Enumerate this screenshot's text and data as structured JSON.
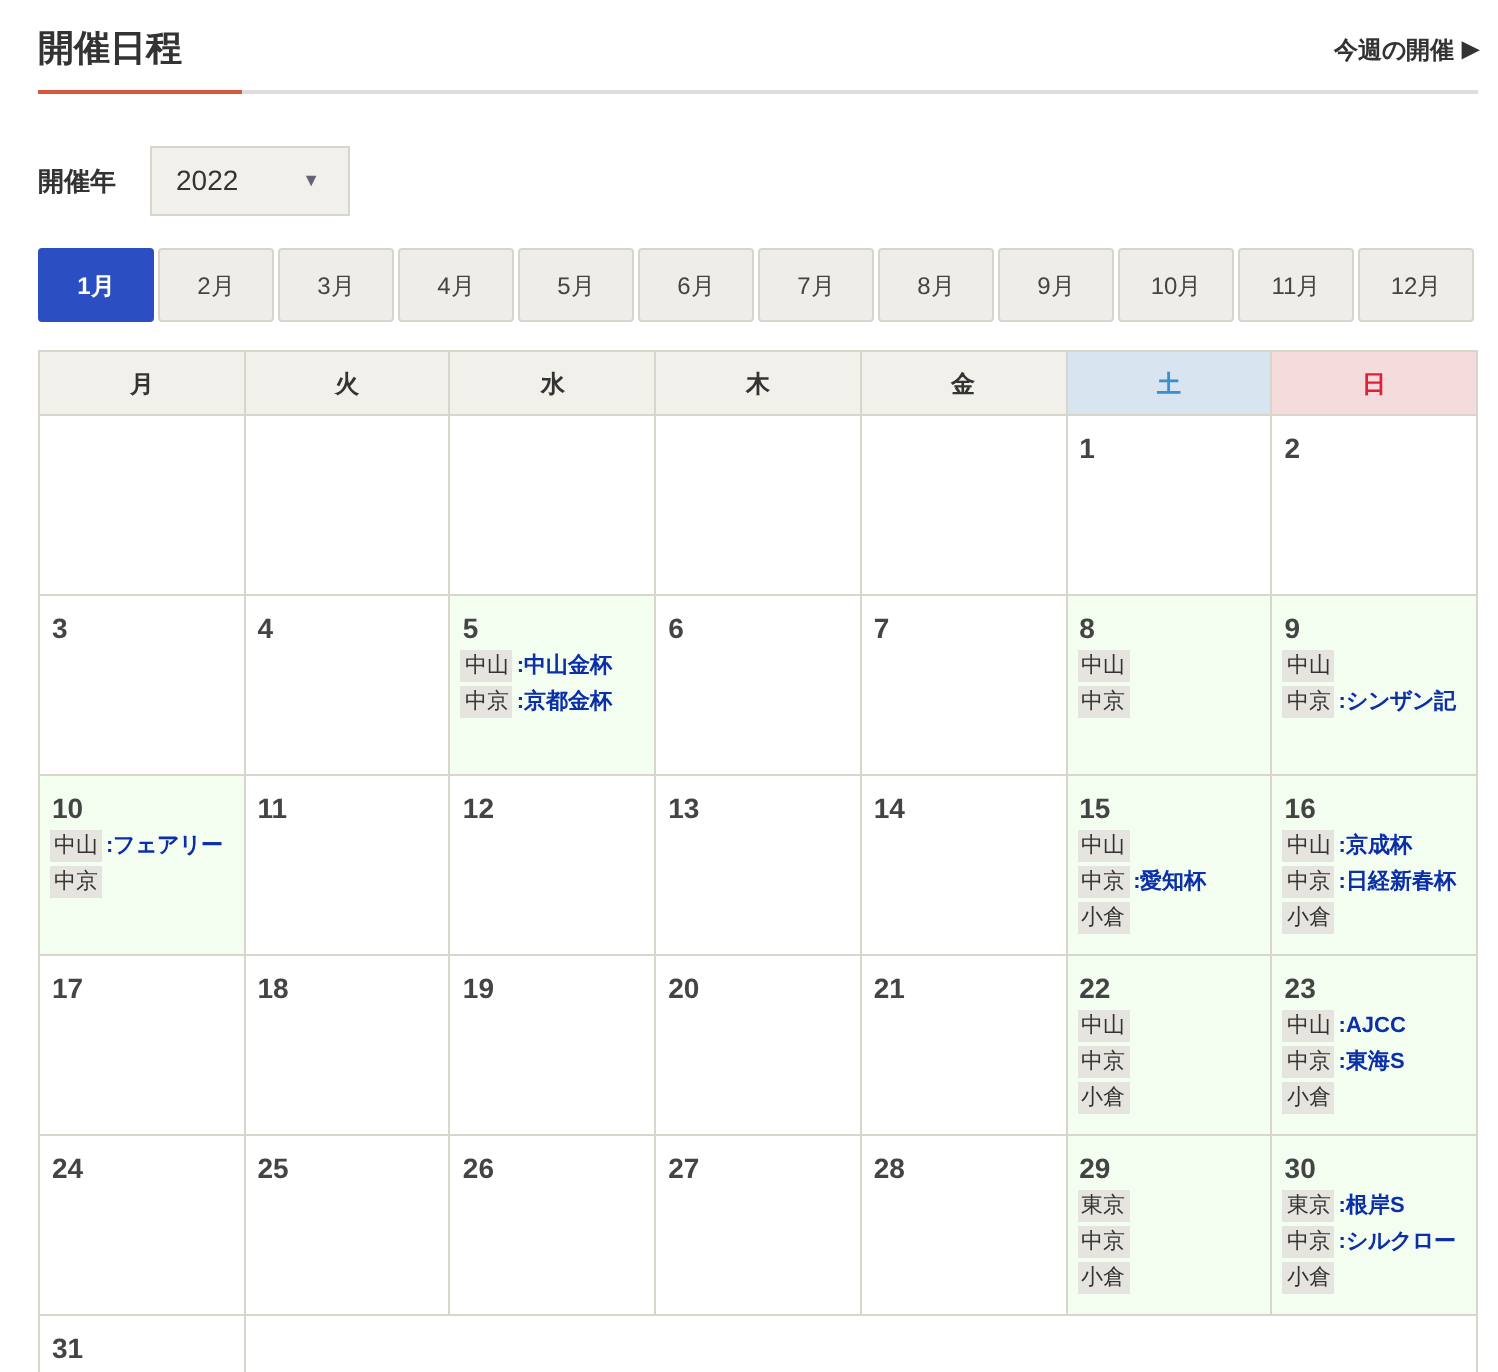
{
  "title": "開催日程",
  "this_week_link": "今週の開催",
  "this_week_arrow": "▶",
  "year_label": "開催年",
  "year_select": {
    "value": "2022",
    "caret": "▼"
  },
  "month_tabs": [
    {
      "label": "1月",
      "selected": true
    },
    {
      "label": "2月",
      "selected": false
    },
    {
      "label": "3月",
      "selected": false
    },
    {
      "label": "4月",
      "selected": false
    },
    {
      "label": "5月",
      "selected": false
    },
    {
      "label": "6月",
      "selected": false
    },
    {
      "label": "7月",
      "selected": false
    },
    {
      "label": "8月",
      "selected": false
    },
    {
      "label": "9月",
      "selected": false
    },
    {
      "label": "10月",
      "selected": false
    },
    {
      "label": "11月",
      "selected": false
    },
    {
      "label": "12月",
      "selected": false
    }
  ],
  "calendar": {
    "weekdays": [
      {
        "label": "月",
        "kind": "weekday"
      },
      {
        "label": "火",
        "kind": "weekday"
      },
      {
        "label": "水",
        "kind": "weekday"
      },
      {
        "label": "木",
        "kind": "weekday"
      },
      {
        "label": "金",
        "kind": "weekday"
      },
      {
        "label": "土",
        "kind": "saturday"
      },
      {
        "label": "日",
        "kind": "sunday"
      }
    ],
    "weeks": [
      [
        {
          "kind": "empty"
        },
        {
          "kind": "empty"
        },
        {
          "kind": "empty"
        },
        {
          "kind": "empty"
        },
        {
          "kind": "empty"
        },
        {
          "kind": "day",
          "day": "1"
        },
        {
          "kind": "day",
          "day": "2"
        }
      ],
      [
        {
          "kind": "day",
          "day": "3"
        },
        {
          "kind": "day",
          "day": "4"
        },
        {
          "kind": "day",
          "day": "5",
          "meetings": [
            {
              "venue": "中山",
              "race": ":中山金杯"
            },
            {
              "venue": "中京",
              "race": ":京都金杯"
            }
          ]
        },
        {
          "kind": "day",
          "day": "6"
        },
        {
          "kind": "day",
          "day": "7"
        },
        {
          "kind": "day",
          "day": "8",
          "meetings": [
            {
              "venue": "中山"
            },
            {
              "venue": "中京"
            }
          ]
        },
        {
          "kind": "day",
          "day": "9",
          "meetings": [
            {
              "venue": "中山"
            },
            {
              "venue": "中京",
              "race": ":シンザン記"
            }
          ]
        }
      ],
      [
        {
          "kind": "day",
          "day": "10",
          "meetings": [
            {
              "venue": "中山",
              "race": ":フェアリー"
            },
            {
              "venue": "中京"
            }
          ]
        },
        {
          "kind": "day",
          "day": "11"
        },
        {
          "kind": "day",
          "day": "12"
        },
        {
          "kind": "day",
          "day": "13"
        },
        {
          "kind": "day",
          "day": "14"
        },
        {
          "kind": "day",
          "day": "15",
          "meetings": [
            {
              "venue": "中山"
            },
            {
              "venue": "中京",
              "race": ":愛知杯"
            },
            {
              "venue": "小倉"
            }
          ]
        },
        {
          "kind": "day",
          "day": "16",
          "meetings": [
            {
              "venue": "中山",
              "race": ":京成杯"
            },
            {
              "venue": "中京",
              "race": ":日経新春杯"
            },
            {
              "venue": "小倉"
            }
          ]
        }
      ],
      [
        {
          "kind": "day",
          "day": "17"
        },
        {
          "kind": "day",
          "day": "18"
        },
        {
          "kind": "day",
          "day": "19"
        },
        {
          "kind": "day",
          "day": "20"
        },
        {
          "kind": "day",
          "day": "21"
        },
        {
          "kind": "day",
          "day": "22",
          "meetings": [
            {
              "venue": "中山"
            },
            {
              "venue": "中京"
            },
            {
              "venue": "小倉"
            }
          ]
        },
        {
          "kind": "day",
          "day": "23",
          "meetings": [
            {
              "venue": "中山",
              "race": ":AJCC"
            },
            {
              "venue": "中京",
              "race": ":東海S"
            },
            {
              "venue": "小倉"
            }
          ]
        }
      ],
      [
        {
          "kind": "day",
          "day": "24"
        },
        {
          "kind": "day",
          "day": "25"
        },
        {
          "kind": "day",
          "day": "26"
        },
        {
          "kind": "day",
          "day": "27"
        },
        {
          "kind": "day",
          "day": "28"
        },
        {
          "kind": "day",
          "day": "29",
          "meetings": [
            {
              "venue": "東京"
            },
            {
              "venue": "中京"
            },
            {
              "venue": "小倉"
            }
          ]
        },
        {
          "kind": "day",
          "day": "30",
          "meetings": [
            {
              "venue": "東京",
              "race": ":根岸S"
            },
            {
              "venue": "中京",
              "race": ":シルクロー"
            },
            {
              "venue": "小倉"
            }
          ]
        }
      ],
      [
        {
          "kind": "day",
          "day": "31"
        }
      ]
    ]
  }
}
